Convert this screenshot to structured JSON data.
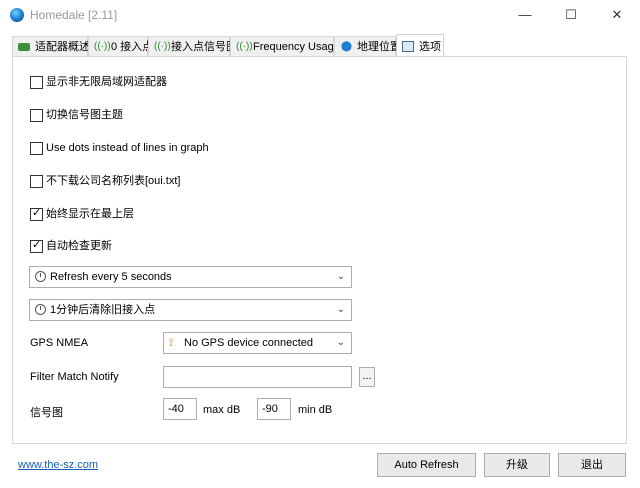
{
  "window": {
    "title": "Homedale [2.11]",
    "icon": "globe-icon",
    "controls": {
      "minimize": "—",
      "maximize": "☐",
      "close": "✕"
    }
  },
  "tabs": [
    {
      "label": "适配器概述",
      "icon": "adapter-icon"
    },
    {
      "label": "0 接入点",
      "icon": "signal-icon"
    },
    {
      "label": "接入点信号图",
      "icon": "signal-icon"
    },
    {
      "label": "Frequency Usage",
      "icon": "signal-icon"
    },
    {
      "label": "地理位置",
      "icon": "location-pin-icon"
    },
    {
      "label": "选项",
      "icon": "options-icon",
      "active": true
    }
  ],
  "options": {
    "checkboxes": [
      {
        "label": "显示非无限局域网适配器",
        "checked": false
      },
      {
        "label": "切换信号图主题",
        "checked": false
      },
      {
        "label": "Use dots instead of lines in graph",
        "checked": false
      },
      {
        "label": "不下载公司名称列表[oui.txt]",
        "checked": false
      },
      {
        "label": "始终显示在最上层",
        "checked": true
      },
      {
        "label": "自动检查更新",
        "checked": true
      }
    ],
    "refresh_select": {
      "value": "Refresh every 5 seconds",
      "icon": "clock-icon"
    },
    "clear_select": {
      "value": "1分钟后清除旧接入点",
      "icon": "clock-icon"
    },
    "gps": {
      "label": "GPS NMEA",
      "value": "No GPS device connected",
      "icon": "satellite-icon"
    },
    "filter": {
      "label": "Filter Match Notify",
      "value": "",
      "browse": "..."
    },
    "signal": {
      "label": "信号图",
      "max_value": "-40",
      "max_unit": "max dB",
      "min_value": "-90",
      "min_unit": "min dB"
    }
  },
  "footer": {
    "link": "www.the-sz.com",
    "auto_refresh": "Auto Refresh",
    "upgrade": "升级",
    "exit": "退出"
  }
}
